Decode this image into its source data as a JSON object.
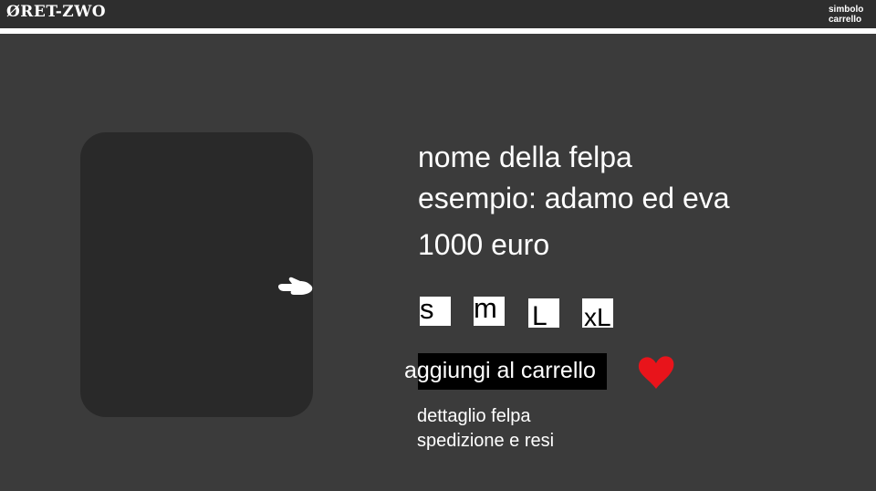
{
  "header": {
    "logo": "ØRET-ZWO",
    "cart_symbol": "simbolo carrello"
  },
  "product": {
    "name": "nome della felpa",
    "example": "esempio: adamo ed eva",
    "price": "1000 euro",
    "image_nav_icon": "pointing-hand-icon"
  },
  "sizes": [
    {
      "label": "s"
    },
    {
      "label": "m"
    },
    {
      "label": "L"
    },
    {
      "label": "xL"
    }
  ],
  "actions": {
    "add_to_cart": "aggiungi al carrello",
    "favorite_icon": "heart-icon",
    "favorite_color": "#e8141b"
  },
  "links": {
    "detail": "dettaglio felpa",
    "shipping": "spedizione e resi"
  }
}
